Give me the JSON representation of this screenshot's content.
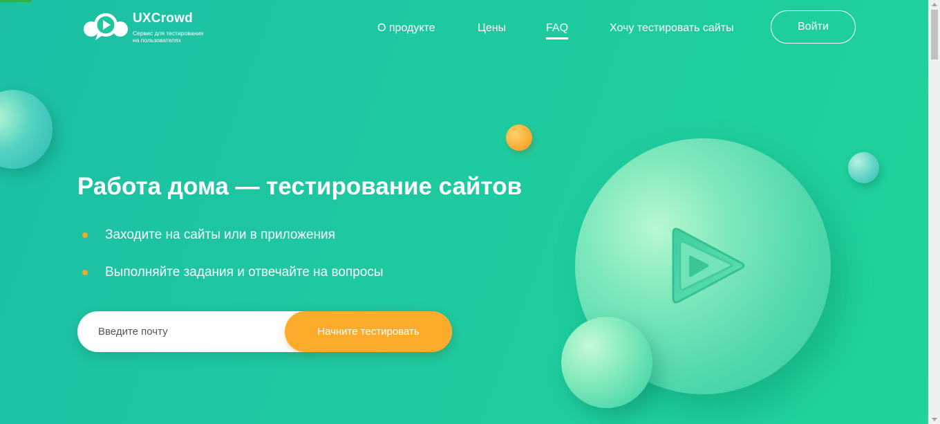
{
  "brand": {
    "name": "UXCrowd",
    "tagline_line1": "Сервис для тестирования",
    "tagline_line2": "на пользователях"
  },
  "nav": {
    "items": [
      {
        "label": "О продукте",
        "active": false
      },
      {
        "label": "Цены",
        "active": false
      },
      {
        "label": "FAQ",
        "active": true
      },
      {
        "label": "Хочу тестировать сайты",
        "active": false
      }
    ],
    "login_label": "Войти"
  },
  "hero": {
    "title": "Работа дома — тестирование сайтов",
    "bullets": [
      "Заходите на сайты или в приложения",
      "Выполняйте задания и отвечайте на вопросы"
    ],
    "email_placeholder": "Введите почту",
    "cta_label": "Начните тестировать"
  },
  "colors": {
    "accent": "#fcac2a",
    "background": "#1ec9a0",
    "text": "#ffffff"
  },
  "icons": [
    "logo-chat-bubbles-icon",
    "play-icon"
  ]
}
